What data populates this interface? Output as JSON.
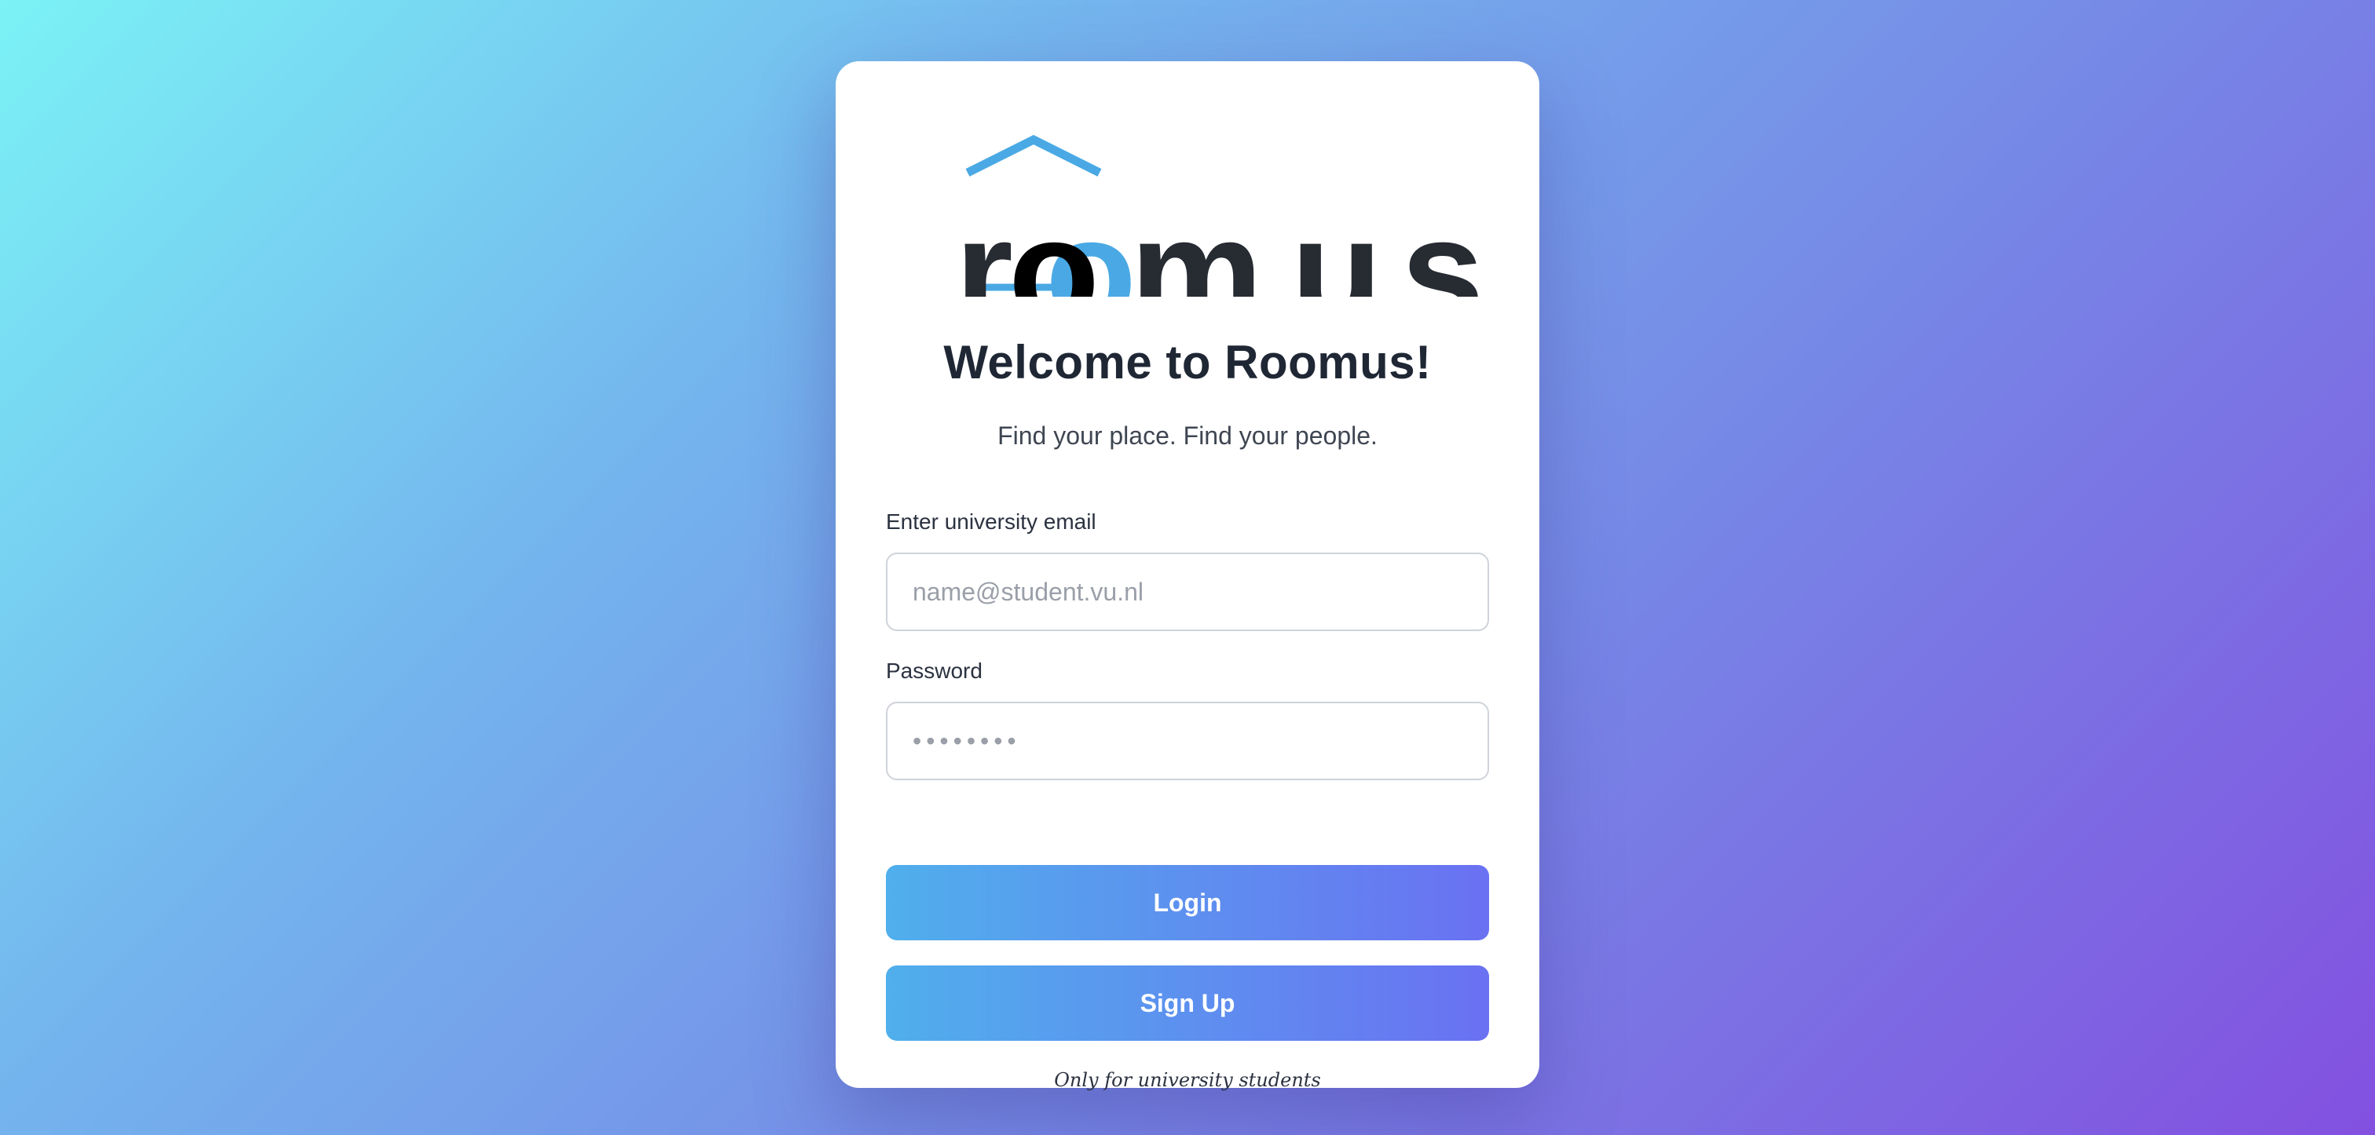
{
  "logo": {
    "text": "roomus",
    "letters": [
      "r",
      "o",
      "o",
      "m",
      "u",
      "s"
    ],
    "colors": {
      "text": "#272b32",
      "accent": "#4aa9e4",
      "black": "#000000"
    },
    "icon_name": "house-roof-icon"
  },
  "welcome": {
    "title": "Welcome to Roomus!",
    "subtitle": "Find your place. Find your people."
  },
  "form": {
    "email_label": "Enter university email",
    "email_placeholder": "name@student.vu.nl",
    "email_value": "",
    "password_label": "Password",
    "password_placeholder": "••••••••",
    "password_value": ""
  },
  "buttons": {
    "login": "Login",
    "signup": "Sign Up"
  },
  "footnote": "Only for university students",
  "colors": {
    "button_gradient_start": "#50afec",
    "button_gradient_end": "#6a71f2",
    "background_start": "#7bf2f5",
    "background_end": "#8350e0"
  }
}
